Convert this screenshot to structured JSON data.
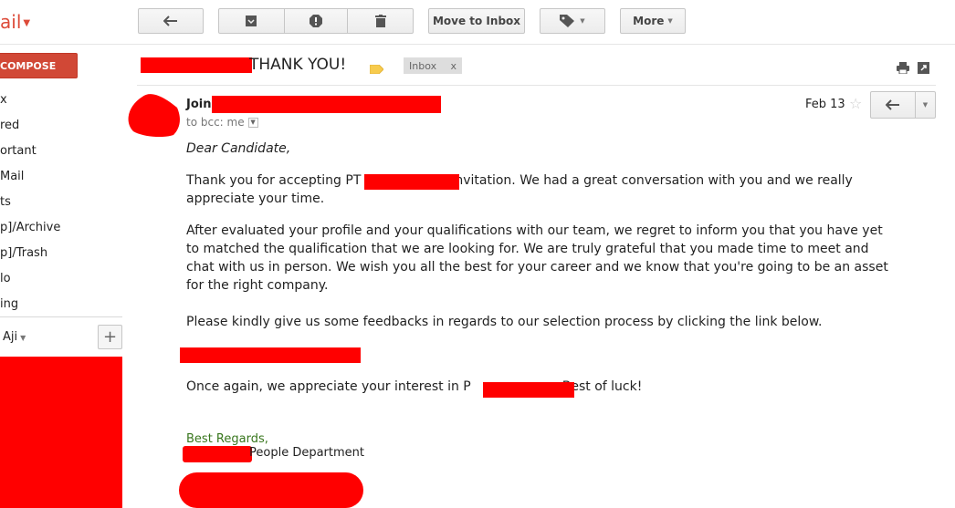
{
  "app": {
    "logo_text": "ail"
  },
  "toolbar": {
    "move_to_inbox_label": "Move to Inbox",
    "more_label": "More"
  },
  "sidebar": {
    "compose_label": "COMPOSE",
    "items": [
      {
        "label": "x"
      },
      {
        "label": "red"
      },
      {
        "label": "ortant"
      },
      {
        "label": " Mail"
      },
      {
        "label": "ts"
      },
      {
        "label": "p]/Archive"
      },
      {
        "label": "p]/Trash"
      },
      {
        "label": "lo"
      },
      {
        "label": "ing"
      }
    ],
    "user_name": "Aji",
    "add_label": "+"
  },
  "message": {
    "subject": "THANK YOU!",
    "label_chip": "Inbox",
    "label_chip_close": "x",
    "sender_prefix": "Join",
    "recipients": "to bcc: me",
    "date": "Feb 13",
    "greeting": "Dear Candidate,",
    "para1_line1_pre": "Thank you for accepting PT",
    "para1_line1_post": "nvitation. We had a great conversation with you and we really",
    "para1_line2": "appreciate your time.",
    "para2": [
      "After evaluated your profile and your qualifications with our team, we regret to inform you that you have yet",
      "to matched the qualification that we are looking for. We are truly grateful that you made time to meet and",
      "chat with us in person. We wish you all the best for your career and we know that you're going to be an asset",
      "for the right company."
    ],
    "para3": "Please kindly give us some feedbacks in regards to our selection process by clicking the link below.",
    "para4_pre": "Once again, we appreciate your interest in P",
    "para4_post": "Best of luck!",
    "regards": "Best Regards,",
    "signature_suffix": "People Department"
  },
  "colors": {
    "redaction": "#ff0000",
    "compose": "#d14836",
    "regards": "#38761d"
  }
}
